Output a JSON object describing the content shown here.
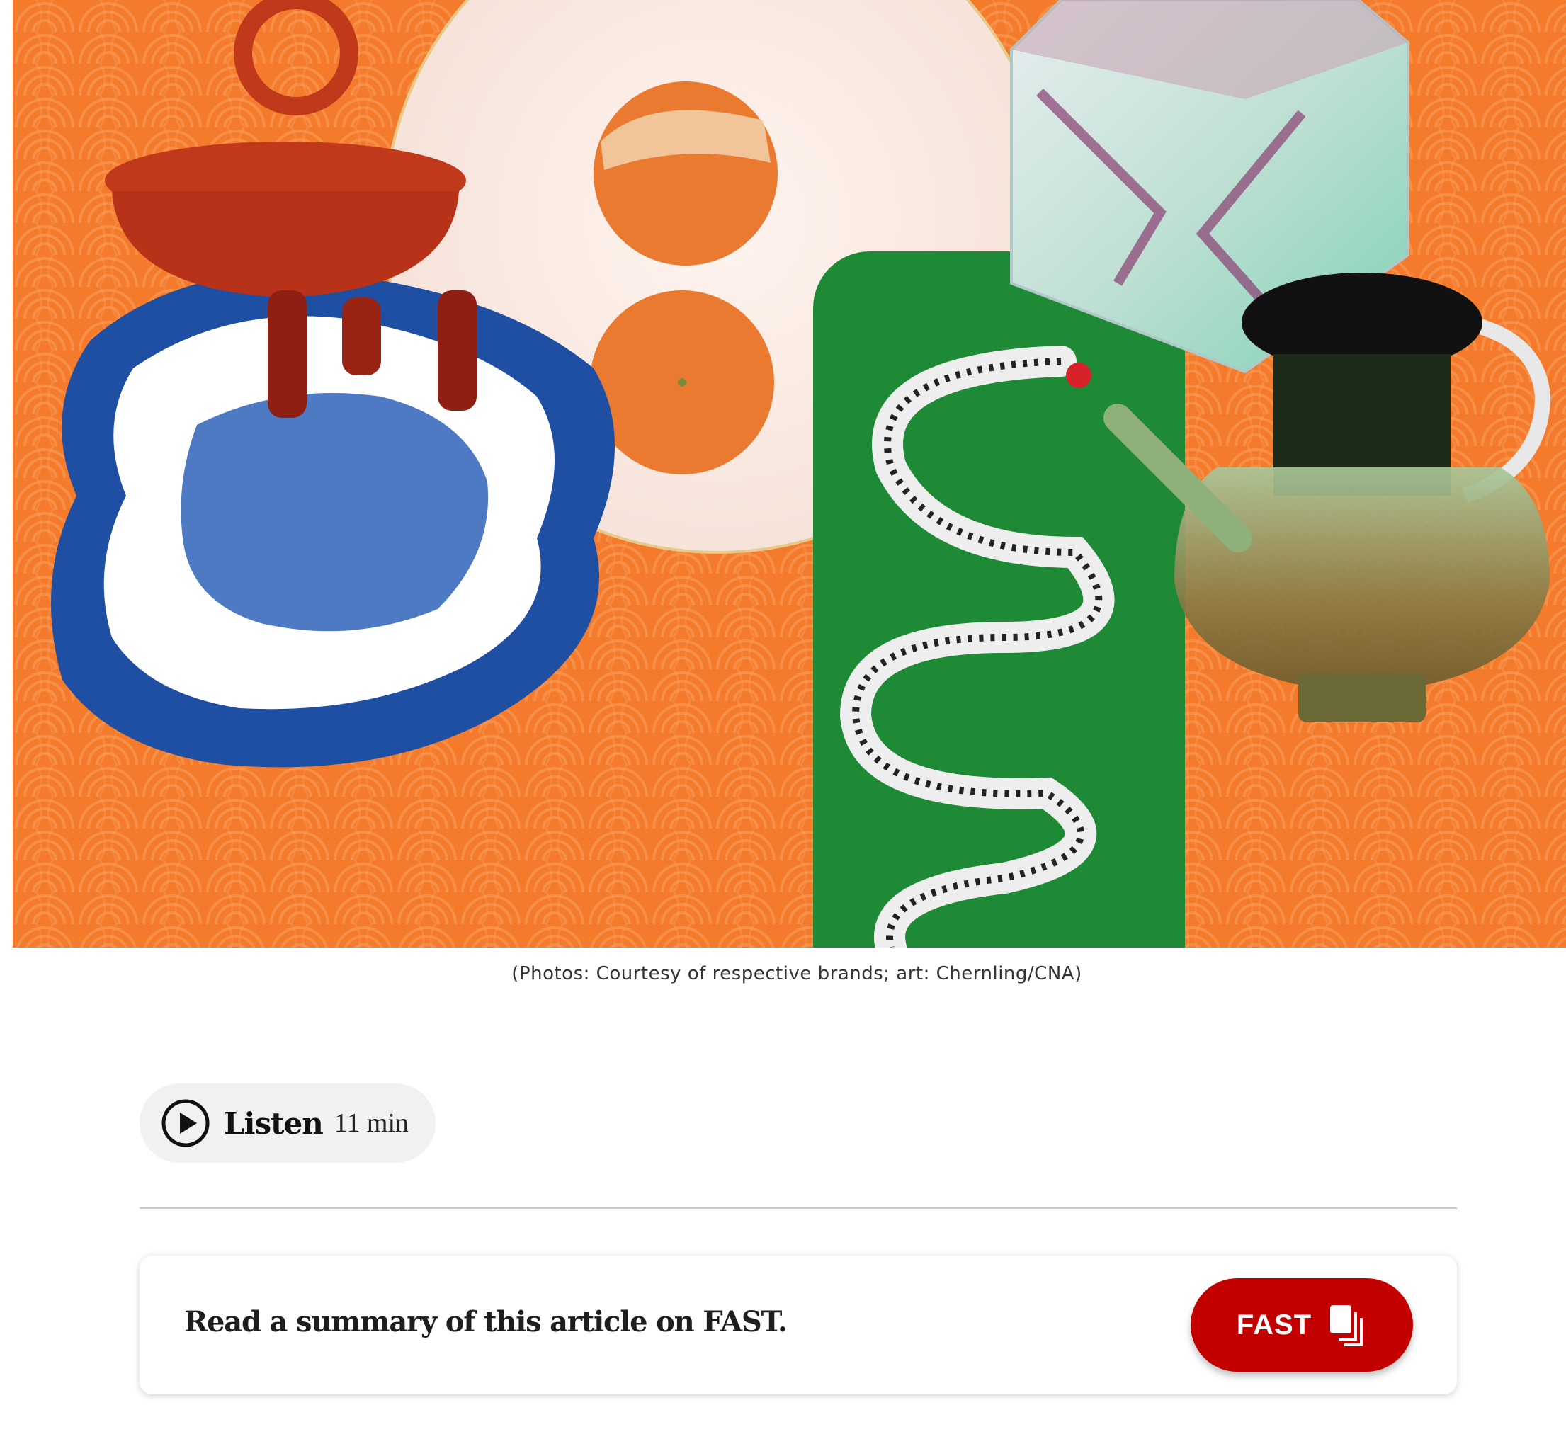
{
  "hero_image": {
    "description_icon": "tableware-collage-image",
    "colors": {
      "background": "#f47a2c",
      "plate_blue": "#1f4fa3",
      "bowl_red": "#c0391b",
      "tray_green": "#1f8a35",
      "glass_green": "#8fb07a"
    }
  },
  "caption": {
    "text": "(Photos: Courtesy of respective brands; art: Chernling/CNA)"
  },
  "listen": {
    "label": "Listen",
    "duration": "11 min",
    "icon": "play-icon"
  },
  "summary": {
    "text": "Read a summary of this article on FAST.",
    "button_label": "FAST",
    "button_icon": "fast-pages-icon",
    "button_color": "#c30000"
  }
}
